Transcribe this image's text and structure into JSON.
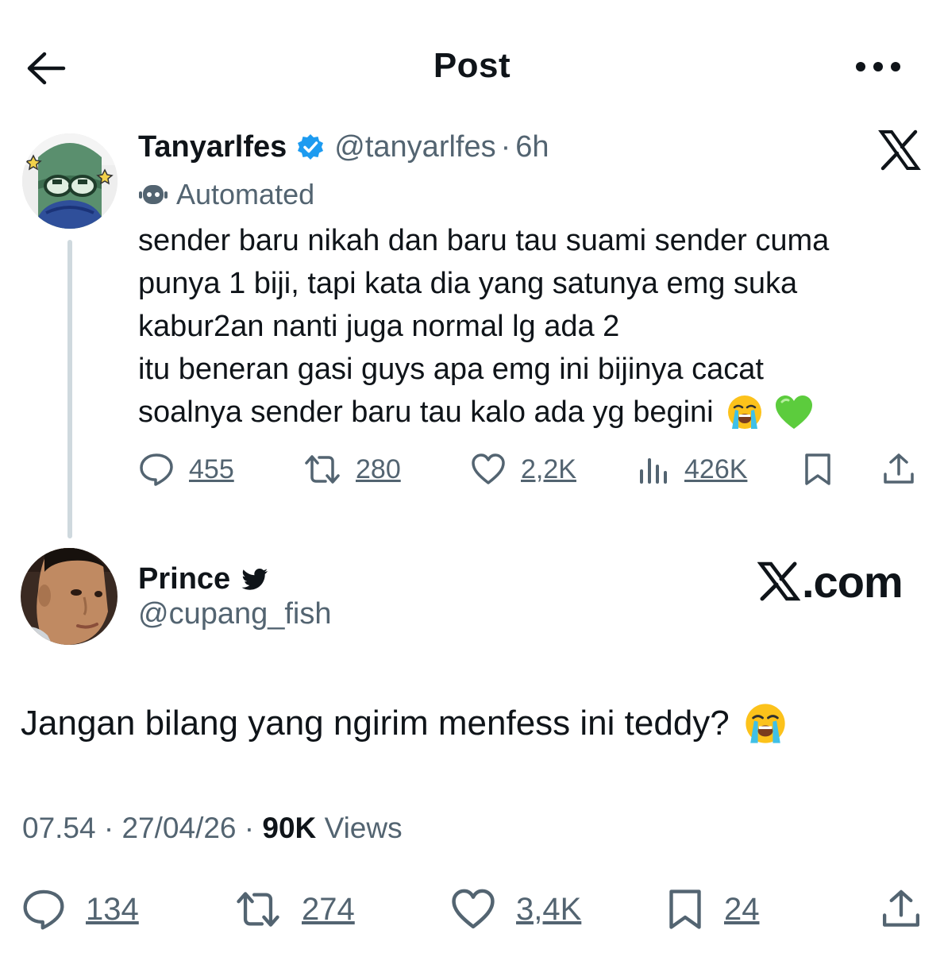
{
  "header": {
    "title": "Post",
    "back_icon": "arrow-left-icon",
    "more_icon": "more-horizontal-icon"
  },
  "quoted_post": {
    "author_name": "Tanyarlfes",
    "author_handle": "@tanyarlfes",
    "separator": "·",
    "time": "6h",
    "automated_label": "Automated",
    "lines": [
      "sender baru nikah dan baru tau suami sender cuma",
      "punya 1 biji, tapi kata dia yang satunya emg suka",
      "kabur2an nanti juga normal lg ada 2",
      "itu beneran gasi guys apa emg ini bijinya cacat",
      "soalnya sender baru tau kalo ada yg begini"
    ],
    "emojis": [
      "loudly-crying-face",
      "green-heart"
    ],
    "stats": {
      "replies": "455",
      "reposts": "280",
      "likes": "2,2K",
      "views": "426K"
    }
  },
  "main_post": {
    "author_name": "Prince",
    "author_handle": "@cupang_fish",
    "watermark": ".com",
    "text": "Jangan bilang yang ngirim menfess ini teddy?",
    "emoji": "loudly-crying-face",
    "time": "07.54",
    "sep1": " · ",
    "date": "27/04/26",
    "sep2": " · ",
    "views_count": "90K",
    "views_label": " Views",
    "stats": {
      "replies": "134",
      "reposts": "274",
      "likes": "3,4K",
      "bookmarks": "24"
    }
  },
  "colors": {
    "text": "#0f1419",
    "secondary": "#536471",
    "verified": "#1d9bf0",
    "thread_line": "#cfd9de"
  }
}
